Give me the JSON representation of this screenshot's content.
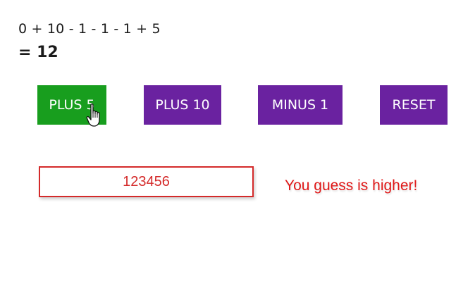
{
  "expression": {
    "text": "0 + 10 - 1 - 1 - 1 + 5",
    "result": "= 12"
  },
  "buttons": {
    "plus5": "PLUS 5",
    "plus10": "PLUS 10",
    "minus1": "MINUS 1",
    "reset": "RESET"
  },
  "guess": {
    "value": "123456"
  },
  "hint": {
    "text": "You guess is higher!"
  },
  "colors": {
    "active_button": "#189e1e",
    "button": "#6a22a0",
    "guess_border": "#d42a2a",
    "guess_text": "#d42a2a",
    "hint_text": "#e01818"
  },
  "icons": {
    "cursor": "hand-pointer-icon"
  }
}
